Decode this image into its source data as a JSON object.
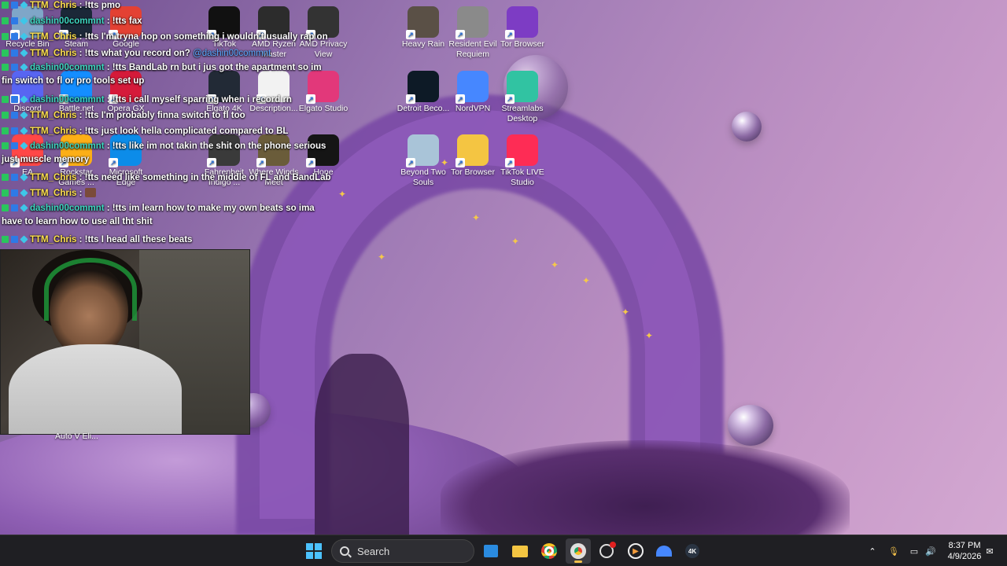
{
  "desktop_icons": [
    {
      "label": "Recycle Bin",
      "icon": "recycle-bin-icon",
      "color": "#7fa6c8"
    },
    {
      "label": "Steam",
      "icon": "steam-icon",
      "color": "#1b2838"
    },
    {
      "label": "Google",
      "icon": "chrome-icon",
      "color": "#e34133"
    },
    {
      "label": "TikTok",
      "icon": "tiktok-icon",
      "color": "#111111"
    },
    {
      "label": "AMD Ryzen Master",
      "icon": "amd-ryzen-icon",
      "color": "#2c2c2c"
    },
    {
      "label": "AMD Privacy View",
      "icon": "privacy-eye-icon",
      "color": "#333333"
    },
    {
      "label": "Heavy Rain",
      "icon": "heavy-rain-icon",
      "color": "#5a5046"
    },
    {
      "label": "Resident Evil Requiem",
      "icon": "resident-evil-icon",
      "color": "#8a8a8a"
    },
    {
      "label": "Tor Browser",
      "icon": "tor-icon",
      "color": "#7d3cc4"
    },
    {
      "label": "Discord",
      "icon": "discord-icon",
      "color": "#5865f2"
    },
    {
      "label": "Battle.net",
      "icon": "battlenet-icon",
      "color": "#148eff"
    },
    {
      "label": "Opera GX",
      "icon": "opera-gx-icon",
      "color": "#d51a3a"
    },
    {
      "label": "Elgato 4K",
      "icon": "elgato-4k-icon",
      "color": "#222a36"
    },
    {
      "label": "Description...",
      "icon": "document-icon",
      "color": "#f2f2f2"
    },
    {
      "label": "Elgato Studio",
      "icon": "elgato-studio-icon",
      "color": "#e2387a"
    },
    {
      "label": "Detroit Beco...",
      "icon": "detroit-icon",
      "color": "#0d1a26"
    },
    {
      "label": "NordVPN",
      "icon": "nordvpn-icon",
      "color": "#4687ff"
    },
    {
      "label": "Streamlabs Desktop",
      "icon": "streamlabs-icon",
      "color": "#31c3a2"
    },
    {
      "label": "EA",
      "icon": "ea-icon",
      "color": "#ff4747"
    },
    {
      "label": "Rockstar Games ...",
      "icon": "rockstar-icon",
      "color": "#fcaf17"
    },
    {
      "label": "Microsoft Edge",
      "icon": "edge-icon",
      "color": "#0c8ce9"
    },
    {
      "label": "Fahrenheit Indigo ...",
      "icon": "fahrenheit-icon",
      "color": "#3a3a3a"
    },
    {
      "label": "Where Winds Meet",
      "icon": "where-winds-icon",
      "color": "#6a5c3a"
    },
    {
      "label": "Hone",
      "icon": "hone-icon",
      "color": "#151515"
    },
    {
      "label": "Beyond Two Souls",
      "icon": "beyond-two-souls-icon",
      "color": "#a9c4d8"
    },
    {
      "label": "Tor Browser",
      "icon": "folder-icon",
      "color": "#f4c542"
    },
    {
      "label": "TikTok LIVE Studio",
      "icon": "tiktok-live-icon",
      "color": "#fe2c55"
    }
  ],
  "chat": [
    {
      "user": "TTM_Chris",
      "text": ": !tts pmo"
    },
    {
      "user": "dashin00commnt",
      "text": ": !tts fax"
    },
    {
      "user": "TTM_Chris",
      "text": ": !tts I'm tryna hop on something i wouldn't usually rap on"
    },
    {
      "user": "TTM_Chris",
      "text": ": !tts what you record on?",
      "mention": "@dashin00commnt"
    },
    {
      "user": "dashin00commnt",
      "text": ": !tts BandLab rn but i jus got the apartment so im fin switch to fl or pro tools set up"
    },
    {
      "user": "dashin00commnt",
      "text": ": !tts i call myself sparring when i record rn"
    },
    {
      "user": "TTM_Chris",
      "text": ": !tts I'm probably finna switch to fl too"
    },
    {
      "user": "TTM_Chris",
      "text": ": !tts just look hella complicated compared to BL"
    },
    {
      "user": "dashin00commnt",
      "text": ": !tts like im not takin the shit on the phone serious just muscle memory"
    },
    {
      "user": "TTM_Chris",
      "text": ": !tts need like something in the middle of FL and BandLab"
    },
    {
      "user": "TTM_Chris",
      "text": ":"
    },
    {
      "user": "dashin00commnt",
      "text": ": !tts im learn how to make my own beats so ima have to learn how to use all tht shit"
    },
    {
      "user": "TTM_Chris",
      "text": ": !tts I head all these beats"
    }
  ],
  "webcam": {
    "overlay_label": "Auto V Eli..."
  },
  "taskbar": {
    "search_placeholder": "Search",
    "apps": [
      "start-icon",
      "search",
      "store-icon",
      "file-explorer-icon",
      "chrome-icon",
      "chrome-icon",
      "streamlabs-icon",
      "media-player-icon",
      "nordvpn-icon",
      "elgato-4k-icon"
    ]
  },
  "tray": {
    "time": "8:37 PM",
    "date": "4/9/2026"
  }
}
